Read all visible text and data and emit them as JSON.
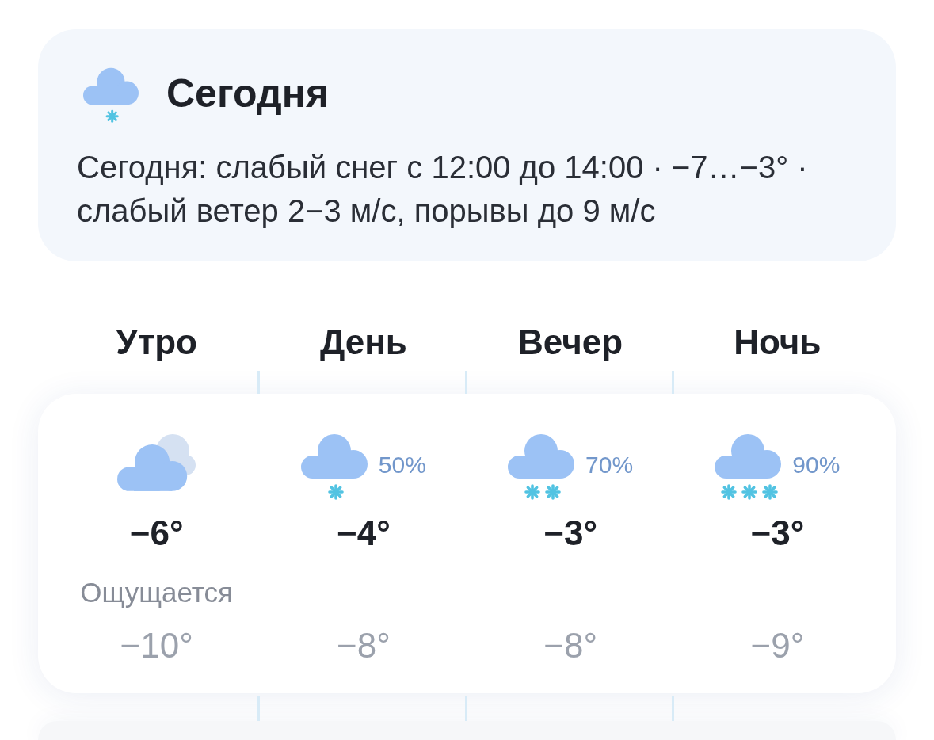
{
  "summary": {
    "kind": "light_snow",
    "title": "Сегодня",
    "text": "Сегодня: слабый снег с 12:00 до 14:00 · −7…−3° · слабый ветер 2−3 м/с, порывы до 9 м/с"
  },
  "periods": [
    {
      "name": "Утро",
      "kind": "overcast",
      "temperature": "−6°",
      "feels_like_label": "Ощущается",
      "feels_like": "−10°"
    },
    {
      "name": "День",
      "kind": "light_snow",
      "precipitation": "50%",
      "temperature": "−4°",
      "feels_like": "−8°"
    },
    {
      "name": "Вечер",
      "kind": "snow",
      "precipitation": "70%",
      "temperature": "−3°",
      "feels_like": "−8°"
    },
    {
      "name": "Ночь",
      "kind": "heavy_snow",
      "precipitation": "90%",
      "temperature": "−3°",
      "feels_like": "−9°"
    }
  ]
}
